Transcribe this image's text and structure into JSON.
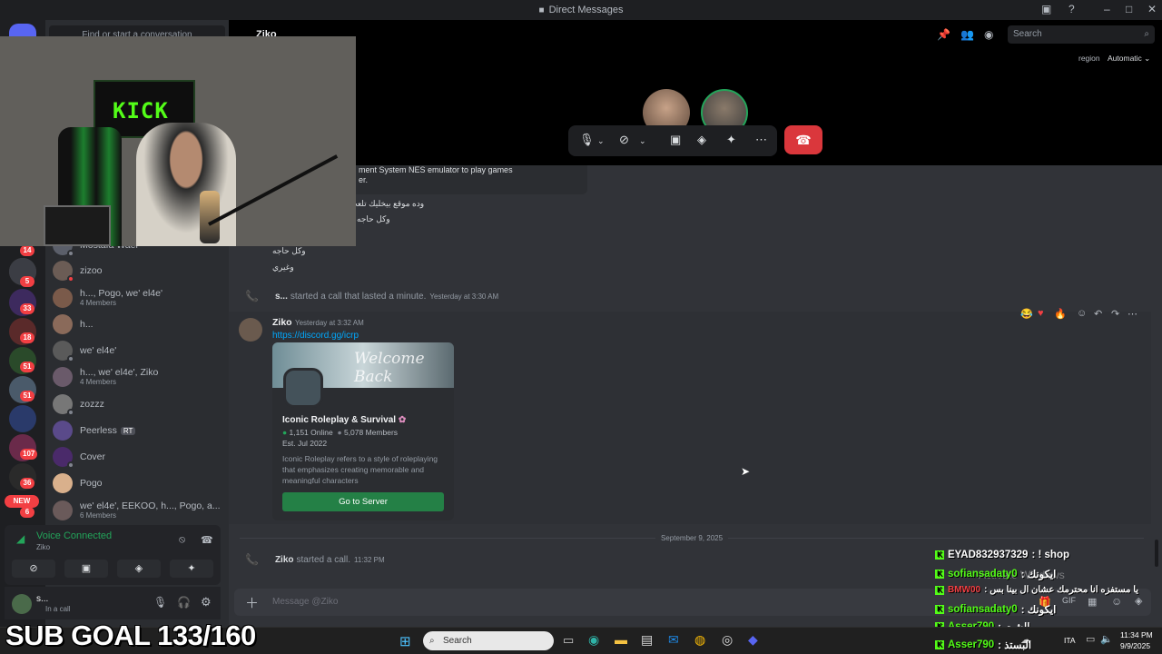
{
  "window": {
    "title": "Direct Messages",
    "search_placeholder": "Search",
    "region_label": "region",
    "region_value": "Automatic"
  },
  "dm_sidebar": {
    "search_placeholder": "Find or start a conversation",
    "items": [
      {
        "name": "Mostafa Wael",
        "sub": ""
      },
      {
        "name": "zizoo",
        "sub": ""
      },
      {
        "name": "h..., Pogo, we' el4e'",
        "sub": "4 Members"
      },
      {
        "name": "h...",
        "sub": ""
      },
      {
        "name": "we' el4e'",
        "sub": ""
      },
      {
        "name": "h..., we' el4e', Ziko",
        "sub": "4 Members"
      },
      {
        "name": "zozzz",
        "sub": ""
      },
      {
        "name": "Peerless",
        "sub": "",
        "badge": "RT"
      },
      {
        "name": "Cover",
        "sub": ""
      },
      {
        "name": "Pogo",
        "sub": ""
      },
      {
        "name": "we' el4e', EEKOO, h..., Pogo, a...",
        "sub": "6 Members"
      }
    ]
  },
  "server_rail": {
    "badges": [
      "14",
      "5",
      "33",
      "18",
      "51",
      "51",
      "107",
      "36",
      "6"
    ],
    "new_label": "NEW"
  },
  "voice_panel": {
    "status": "Voice Connected",
    "channel": "Ziko"
  },
  "user_panel": {
    "name": "s...",
    "status": "In a call"
  },
  "chat": {
    "header_name": "Ziko",
    "embed_snippet_line1": "ment System NES emulator to play games",
    "embed_snippet_line2": "er.",
    "arabic_lines": [
      "وده موقع بيخليك تلعب",
      "وكل حاجه",
      "وكل حاجه",
      "وغيري"
    ],
    "call_log_1": {
      "user": "s...",
      "text": "started a call that lasted a minute.",
      "time": "Yesterday at 3:30 AM"
    },
    "message": {
      "author": "Ziko",
      "time": "Yesterday at 3:32 AM",
      "link": "https://discord.gg/icrp"
    },
    "embed": {
      "banner_text": "Welcome Back",
      "server_name": "Iconic Roleplay & Survival",
      "online": "1,151 Online",
      "members": "5,078 Members",
      "established": "Est. Jul 2022",
      "description": "Iconic Roleplay refers to a style of roleplaying that emphasizes creating memorable and meaningful characters",
      "button": "Go to Server"
    },
    "date_divider": "September 9, 2025",
    "call_log_2": {
      "user": "Ziko",
      "text": "started a call.",
      "time": "11:32 PM"
    },
    "input_placeholder": "Message @Ziko"
  },
  "overlay": {
    "sub_goal": "SUB GOAL 133/160",
    "kick_chat": [
      {
        "user": "EYAD832937329",
        "msg": ": ! shop",
        "color": "white"
      },
      {
        "user": "sofiansadaty0",
        "msg": ": ايكونك",
        "color": "green"
      },
      {
        "user": "BMW00",
        "msg": ": يا مستفزه انا محترمك عشان ال بينا بس",
        "color": "red"
      },
      {
        "user": "sofiansadaty0",
        "msg": ": ايكونك",
        "color": "green"
      },
      {
        "user": "Asser790",
        "msg": ": الشت",
        "color": "green"
      },
      {
        "user": "Asser790",
        "msg": ": البستذ",
        "color": "green"
      }
    ],
    "ghost_text_1": "Activate Windows"
  },
  "taskbar": {
    "search_placeholder": "Search",
    "lang": "ITA",
    "time": "11:34 PM",
    "date": "9/9/2025"
  }
}
